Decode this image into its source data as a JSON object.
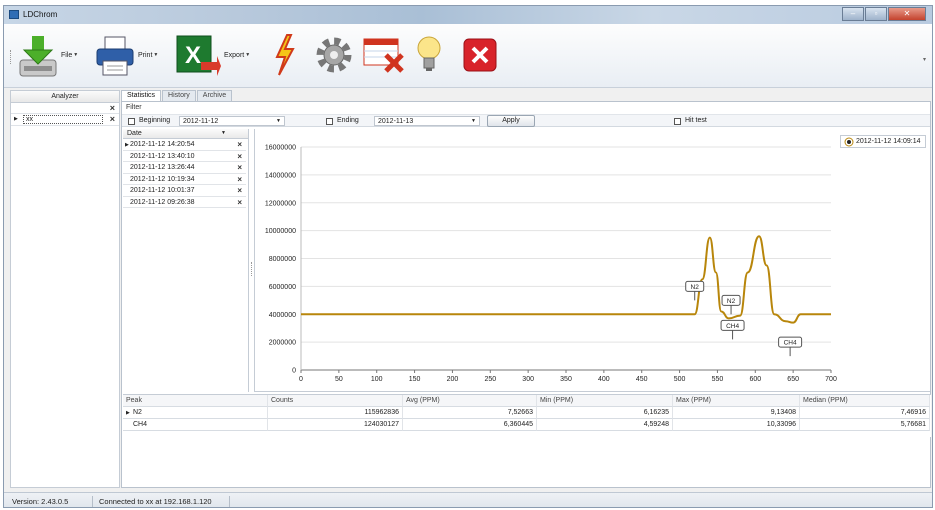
{
  "window": {
    "title": "LDChrom"
  },
  "toolbar": {
    "file_label": "File",
    "print_label": "Print",
    "export_label": "Export"
  },
  "analyzer": {
    "header": "Analyzer",
    "rows": [
      "xx"
    ]
  },
  "tabs": [
    "Statistics",
    "History",
    "Archive"
  ],
  "filter": {
    "label": "Filter",
    "beginning_label": "Beginning",
    "beginning_value": "2012-11-12",
    "ending_label": "Ending",
    "ending_value": "2012-11-13",
    "apply_label": "Apply",
    "hit_test_label": "Hit test"
  },
  "dates": {
    "header": "Date",
    "rows": [
      "2012-11-12 14:20:54",
      "2012-11-12 13:40:10",
      "2012-11-12 13:26:44",
      "2012-11-12 10:19:34",
      "2012-11-12 10:01:37",
      "2012-11-12 09:26:38"
    ]
  },
  "chart_data": {
    "type": "line",
    "legend": "2012-11-12 14:09:14",
    "legend_position": "top-right",
    "series_color": "#b8860b",
    "xlim": [
      0,
      700
    ],
    "ylim": [
      0,
      16000000
    ],
    "x_ticks": [
      "0",
      "50",
      "100",
      "150",
      "200",
      "250",
      "300",
      "350",
      "400",
      "450",
      "500",
      "550",
      "600",
      "650",
      "700"
    ],
    "y_ticks": [
      "0",
      "2000000",
      "4000000",
      "6000000",
      "8000000",
      "10000000",
      "12000000",
      "14000000",
      "16000000"
    ],
    "grid": "horizontal",
    "x": [
      0,
      100,
      200,
      300,
      400,
      500,
      520,
      530,
      540,
      548,
      555,
      565,
      580,
      590,
      605,
      615,
      625,
      640,
      650,
      660,
      670,
      700
    ],
    "y": [
      4000000,
      4000000,
      4000000,
      4000000,
      4000000,
      4000000,
      4000000,
      6500000,
      9500000,
      7000000,
      4200000,
      3700000,
      3900000,
      7000000,
      9600000,
      7500000,
      4000000,
      3500000,
      3400000,
      4000000,
      4000000,
      4000000
    ],
    "annotations": [
      {
        "text": "N2",
        "x": 520,
        "y": 6000000
      },
      {
        "text": "N2",
        "x": 568,
        "y": 5000000
      },
      {
        "text": "CH4",
        "x": 570,
        "y": 3200000
      },
      {
        "text": "CH4",
        "x": 646,
        "y": 2000000
      }
    ]
  },
  "peaks": {
    "headers": [
      "Peak",
      "Counts",
      "Avg (PPM)",
      "Min (PPM)",
      "Max (PPM)",
      "Median (PPM)"
    ],
    "rows": [
      [
        "N2",
        "115962836",
        "7,52663",
        "6,16235",
        "9,13408",
        "7,46916"
      ],
      [
        "CH4",
        "124030127",
        "6,360445",
        "4,59248",
        "10,33096",
        "5,76681"
      ]
    ]
  },
  "status": {
    "version": "Version: 2.43.0.5",
    "connection": "Connected to xx at 192.168.1.120"
  }
}
